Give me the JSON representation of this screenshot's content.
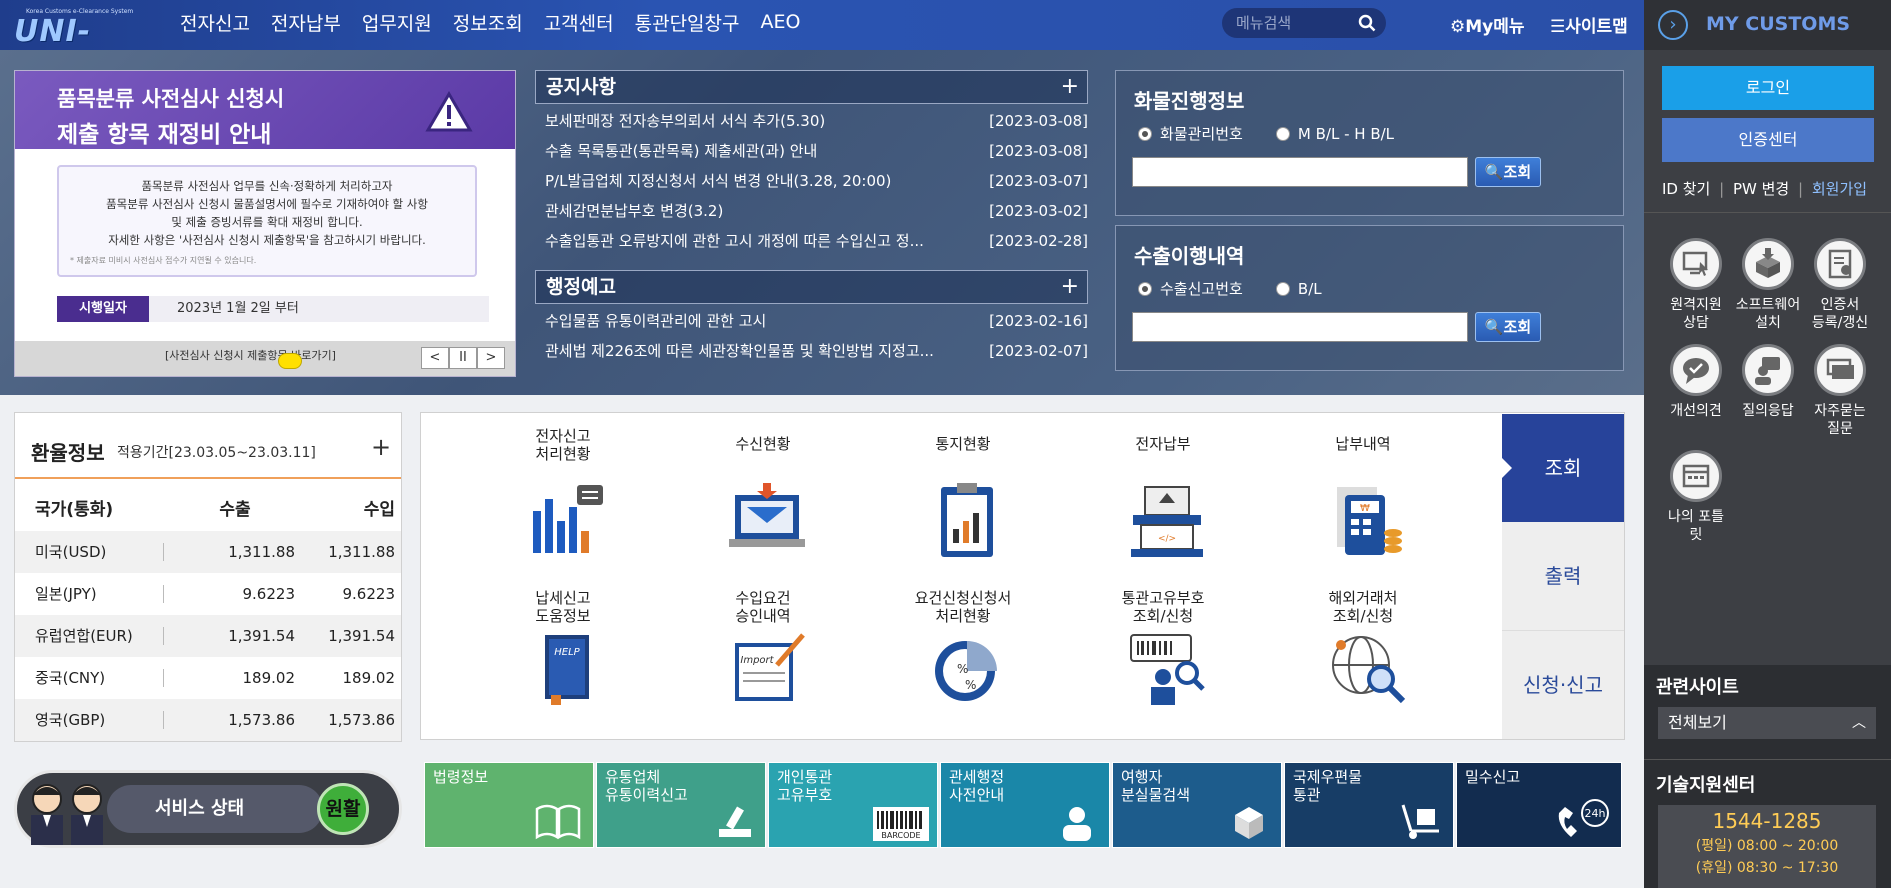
{
  "header": {
    "logo_sub": "Korea Customs e-Clearance System",
    "logo": "UNI-PASS",
    "nav": [
      "전자신고",
      "전자납부",
      "업무지원",
      "정보조회",
      "고객센터",
      "통관단일창구",
      "AEO"
    ],
    "search_placeholder": "메뉴검색",
    "my_menu": "My메뉴",
    "sitemap": "사이트맵"
  },
  "banner": {
    "title_line1": "품목분류 사전심사 신청시",
    "title_line2": "제출 항목 재정비 안내",
    "body": [
      "품목분류 사전심사 업무를 신속·정확하게 처리하고자",
      "품목분류 사전심사 신청시 물품설명서에 필수로 기재하여야 할 사항",
      "및 제출 증빙서류를 확대 재정비 합니다.",
      "자세한 사항은 '사전심사 신청시 제출항목'을 참고하시기 바랍니다."
    ],
    "note": "* 제출자료 미비시 사전심사 접수가 지연될 수 있습니다.",
    "date_label": "시행일자",
    "date_value": "2023년 1월 2일 부터",
    "link": "[사전심사 신청시 제출항목 바로가기]",
    "controls": [
      "<",
      "II",
      ">"
    ]
  },
  "notices": {
    "title": "공지사항",
    "plus": "+",
    "items": [
      {
        "text": "보세판매장 전자송부의뢰서 서식 추가(5.30)",
        "date": "[2023-03-08]"
      },
      {
        "text": "수출 목록통관(통관목록) 제출세관(과) 안내",
        "date": "[2023-03-08]"
      },
      {
        "text": "P/L발급업체 지정신청서 서식 변경 안내(3.28, 20:00)",
        "date": "[2023-03-07]"
      },
      {
        "text": "관세감면분납부호 변경(3.2)",
        "date": "[2023-03-02]"
      },
      {
        "text": "수출입통관 오류방지에 관한 고시 개정에 따른 수입신고 정...",
        "date": "[2023-02-28]"
      }
    ]
  },
  "admin_notice": {
    "title": "행정예고",
    "plus": "+",
    "items": [
      {
        "text": "수입물품 유통이력관리에 관한 고시",
        "date": "[2023-02-16]"
      },
      {
        "text": "관세법 제226조에 따른 세관장확인물품 및 확인방법 지정고...",
        "date": "[2023-02-07]"
      }
    ]
  },
  "cargo": {
    "title": "화물진행정보",
    "opt1": "화물관리번호",
    "opt2": "M B/L - H B/L",
    "btn": "조회"
  },
  "export": {
    "title": "수출이행내역",
    "opt1": "수출신고번호",
    "opt2": "B/L",
    "btn": "조회"
  },
  "rates": {
    "title": "환율정보",
    "period": "적용기간[23.03.05~23.03.11]",
    "plus": "+",
    "headers": [
      "국가(통화)",
      "수출",
      "수입"
    ],
    "rows": [
      [
        "미국(USD)",
        "1,311.88",
        "1,311.88"
      ],
      [
        "일본(JPY)",
        "9.6223",
        "9.6223"
      ],
      [
        "유럽연합(EUR)",
        "1,391.54",
        "1,391.54"
      ],
      [
        "중국(CNY)",
        "189.02",
        "189.02"
      ],
      [
        "영국(GBP)",
        "1,573.86",
        "1,573.86"
      ]
    ]
  },
  "services": [
    {
      "l1": "전자신고",
      "l2": "처리현황"
    },
    {
      "l1": "수신현황",
      "l2": ""
    },
    {
      "l1": "통지현황",
      "l2": ""
    },
    {
      "l1": "전자납부",
      "l2": ""
    },
    {
      "l1": "납부내역",
      "l2": ""
    },
    {
      "l1": "납세신고",
      "l2": "도움정보"
    },
    {
      "l1": "수입요건",
      "l2": "승인내역"
    },
    {
      "l1": "요건신청신청서",
      "l2": "처리현황"
    },
    {
      "l1": "통관고유부호",
      "l2": "조회/신청"
    },
    {
      "l1": "해외거래처",
      "l2": "조회/신청"
    }
  ],
  "side_tabs": [
    "조회",
    "출력",
    "신청·신고"
  ],
  "status": {
    "label": "서비스 상태",
    "value": "원활"
  },
  "quick_links": [
    {
      "l1": "법령정보",
      "l2": "",
      "color": "#5fb36e"
    },
    {
      "l1": "유통업체",
      "l2": "유통이력신고",
      "color": "#3fa08a"
    },
    {
      "l1": "개인통관",
      "l2": "고유부호",
      "color": "#2aa3b0"
    },
    {
      "l1": "관세행정",
      "l2": "사전안내",
      "color": "#1a87a8"
    },
    {
      "l1": "여행자",
      "l2": "분실물검색",
      "color": "#1d5c8c"
    },
    {
      "l1": "국제우편물",
      "l2": "통관",
      "color": "#173d66"
    },
    {
      "l1": "밀수신고",
      "l2": "",
      "color": "#122c4f"
    }
  ],
  "right": {
    "title": "MY CUSTOMS",
    "login": "로그인",
    "cert": "인증센터",
    "id_find": "ID 찾기",
    "pw_change": "PW 변경",
    "join": "회원가입",
    "icons": [
      {
        "l1": "원격지원",
        "l2": "상담"
      },
      {
        "l1": "소프트웨어",
        "l2": "설치"
      },
      {
        "l1": "인증서",
        "l2": "등록/갱신"
      },
      {
        "l1": "개선의견",
        "l2": ""
      },
      {
        "l1": "질의응답",
        "l2": ""
      },
      {
        "l1": "자주묻는",
        "l2": "질문"
      },
      {
        "l1": "나의 포틀",
        "l2": "릿"
      }
    ],
    "related_title": "관련사이트",
    "related_select": "전체보기",
    "tech_title": "기술지원센터",
    "tech_phone": "1544-1285",
    "weekday": "(평일) 08:00 ~ 20:00",
    "holiday": "(휴일) 08:30 ~ 17:30"
  },
  "colors": {
    "accent_blue": "#2a54b2",
    "login": "#1a9fe8",
    "cert": "#4c78c9",
    "rate_line": "#f0a05a",
    "tab_active": "#27439a"
  }
}
